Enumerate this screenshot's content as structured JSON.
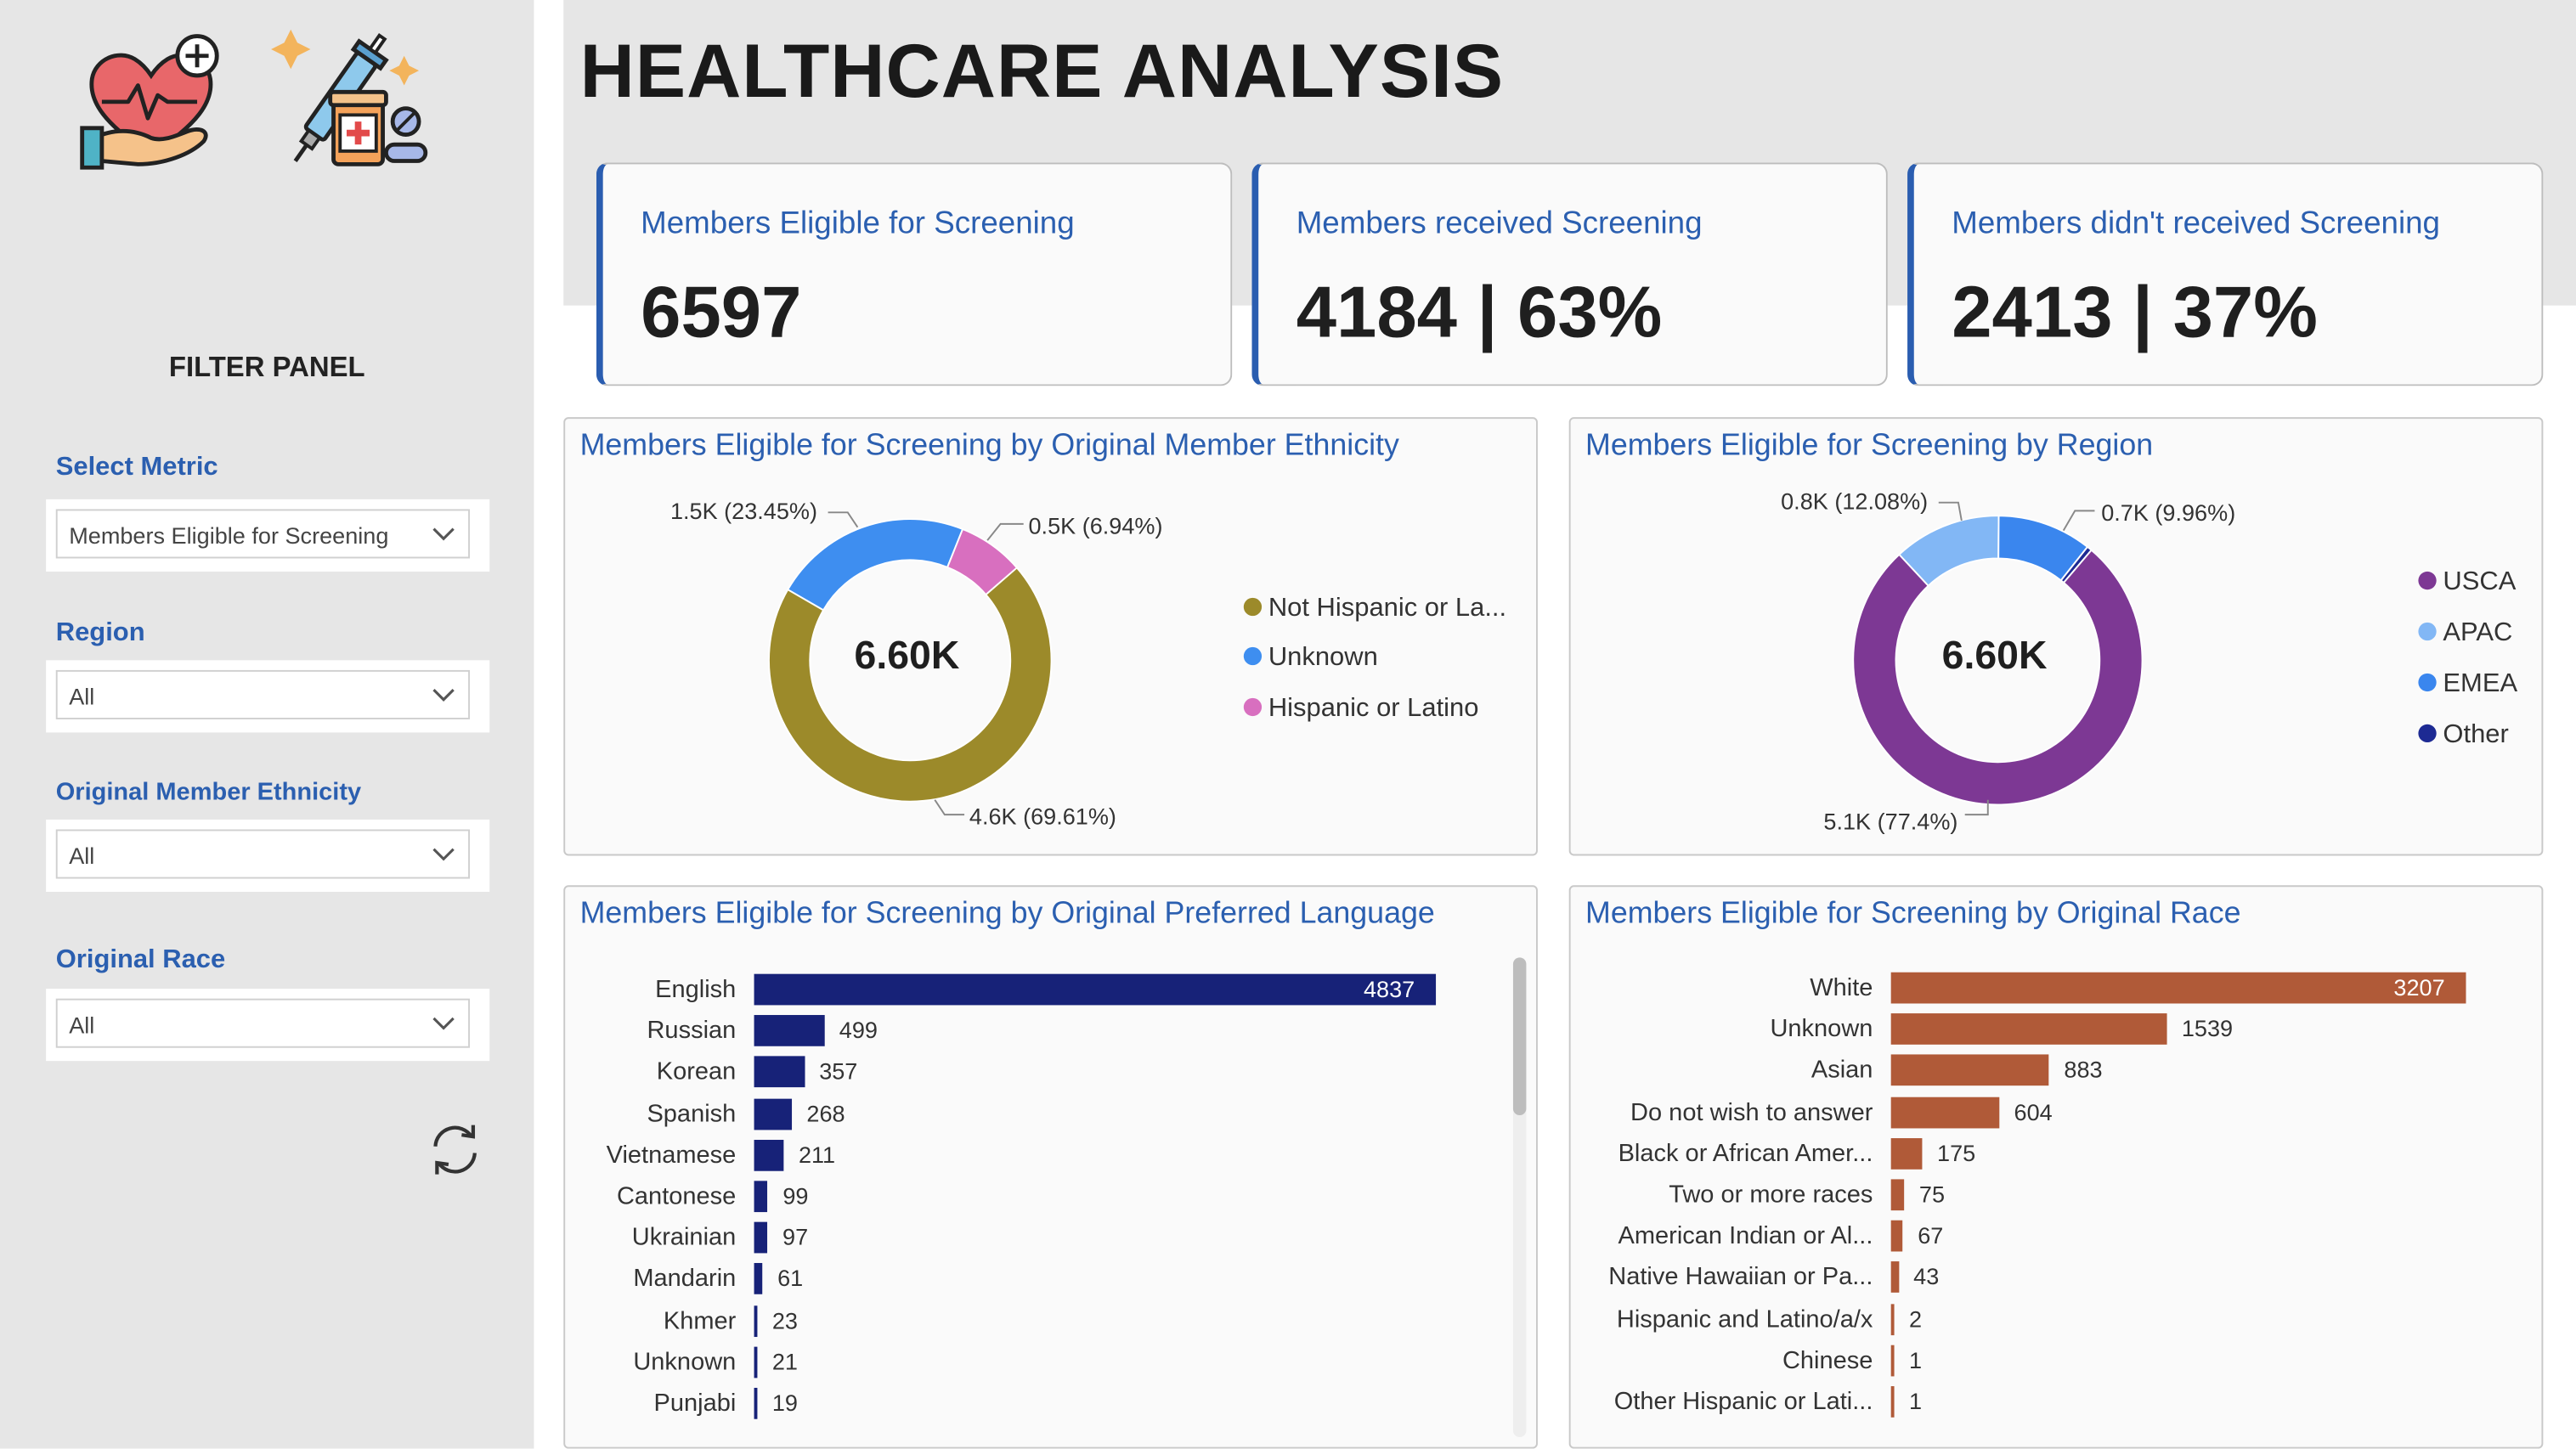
{
  "title": "HEALTHCARE ANALYSIS",
  "sidebar": {
    "panel_title": "FILTER PANEL",
    "filters": [
      {
        "label": "Select Metric",
        "value": "Members Eligible for Screening"
      },
      {
        "label": "Region",
        "value": "All"
      },
      {
        "label": "Original Member Ethnicity",
        "value": "All"
      },
      {
        "label": "Original Race",
        "value": "All"
      }
    ],
    "icons": [
      "heart-hand-icon",
      "syringe-medicine-icon",
      "chevron-down-icon",
      "reset-icon"
    ]
  },
  "kpis": [
    {
      "title": "Members Eligible for Screening",
      "value": "6597"
    },
    {
      "title": "Members received Screening",
      "value": "4184 | 63%"
    },
    {
      "title": "Members didn't received Screening",
      "value": "2413 | 37%"
    }
  ],
  "ethnicity": {
    "title": "Members Eligible for Screening by Original Member Ethnicity",
    "center": "6.60K",
    "labels": [
      "1.5K (23.45%)",
      "0.5K (6.94%)",
      "4.6K (69.61%)"
    ],
    "legend": [
      "Not Hispanic or La...",
      "Unknown",
      "Hispanic or Latino"
    ]
  },
  "region": {
    "title": "Members Eligible for Screening by Region",
    "center": "6.60K",
    "labels": [
      "0.8K (12.08%)",
      "0.7K (9.96%)",
      "5.1K (77.4%)"
    ],
    "legend": [
      "USCA",
      "APAC",
      "EMEA",
      "Other"
    ]
  },
  "language": {
    "title": "Members Eligible for Screening by Original Preferred Language"
  },
  "race": {
    "title": "Members Eligible for Screening by Original Race"
  },
  "colors": {
    "accent": "#2a5db0",
    "ethnicity": [
      "#9c8a2a",
      "#3e8ef0",
      "#d86fbf"
    ],
    "region": [
      "#7d3894",
      "#82b7f5",
      "#3a86ee",
      "#1d2a93"
    ],
    "language_bar": "#172278",
    "race_bar": "#b05a38"
  },
  "chart_data": [
    {
      "type": "pie",
      "title": "Members Eligible for Screening by Original Member Ethnicity",
      "categories": [
        "Not Hispanic or La...",
        "Unknown",
        "Hispanic or Latino"
      ],
      "values": [
        4600,
        1500,
        500
      ],
      "percent": [
        69.61,
        23.45,
        6.94
      ],
      "center_label": "6.60K",
      "legend": "right"
    },
    {
      "type": "pie",
      "title": "Members Eligible for Screening by Region",
      "categories": [
        "USCA",
        "APAC",
        "EMEA",
        "Other"
      ],
      "values": [
        5100,
        800,
        700,
        37
      ],
      "percent": [
        77.4,
        12.08,
        9.96,
        0.56
      ],
      "center_label": "6.60K",
      "legend": "right"
    },
    {
      "type": "bar",
      "orientation": "horizontal",
      "title": "Members Eligible for Screening by Original Preferred Language",
      "categories": [
        "English",
        "Russian",
        "Korean",
        "Spanish",
        "Vietnamese",
        "Cantonese",
        "Ukrainian",
        "Mandarin",
        "Khmer",
        "Unknown",
        "Punjabi"
      ],
      "values": [
        4837,
        499,
        357,
        268,
        211,
        99,
        97,
        61,
        23,
        21,
        19
      ],
      "xlim": [
        0,
        4837
      ]
    },
    {
      "type": "bar",
      "orientation": "horizontal",
      "title": "Members Eligible for Screening by Original Race",
      "categories": [
        "White",
        "Unknown",
        "Asian",
        "Do not wish to answer",
        "Black or African Amer...",
        "Two or more races",
        "American Indian or Al...",
        "Native Hawaiian or Pa...",
        "Hispanic and Latino/a/x",
        "Chinese",
        "Other Hispanic or Lati..."
      ],
      "values": [
        3207,
        1539,
        883,
        604,
        175,
        75,
        67,
        43,
        2,
        1,
        1
      ],
      "xlim": [
        0,
        3207
      ]
    }
  ]
}
